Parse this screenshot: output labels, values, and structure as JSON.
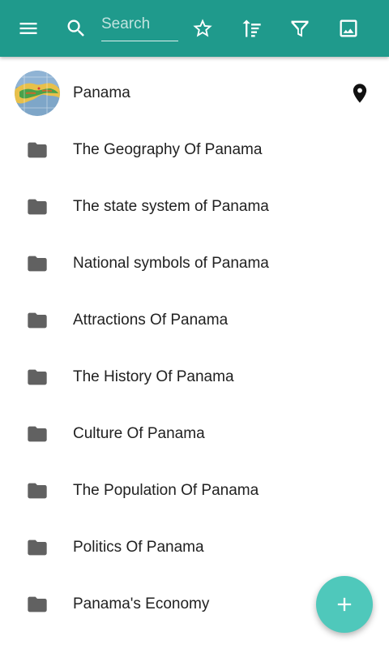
{
  "toolbar": {
    "background": "#1f9a8c",
    "menu_icon": "menu-icon",
    "search_icon": "search-icon",
    "search_placeholder": "Search",
    "search_value": "",
    "star_icon": "star-outline-icon",
    "sort_icon": "sort-icon",
    "filter_icon": "filter-icon",
    "image_icon": "image-icon"
  },
  "list": {
    "header_item": {
      "label": "Panama",
      "thumbnail": "panama-map-thumbnail",
      "trailing_icon": "map-marker-icon"
    },
    "folder_icon": "folder-icon",
    "items": [
      {
        "label": "The Geography Of Panama"
      },
      {
        "label": "The state system of Panama"
      },
      {
        "label": "National symbols of Panama"
      },
      {
        "label": "Attractions Of Panama"
      },
      {
        "label": "The History Of Panama"
      },
      {
        "label": "Culture Of Panama"
      },
      {
        "label": "The Population Of Panama"
      },
      {
        "label": "Politics Of Panama"
      },
      {
        "label": "Panama's Economy"
      }
    ]
  },
  "fab": {
    "icon": "plus-icon",
    "color": "#4fc8bb"
  }
}
